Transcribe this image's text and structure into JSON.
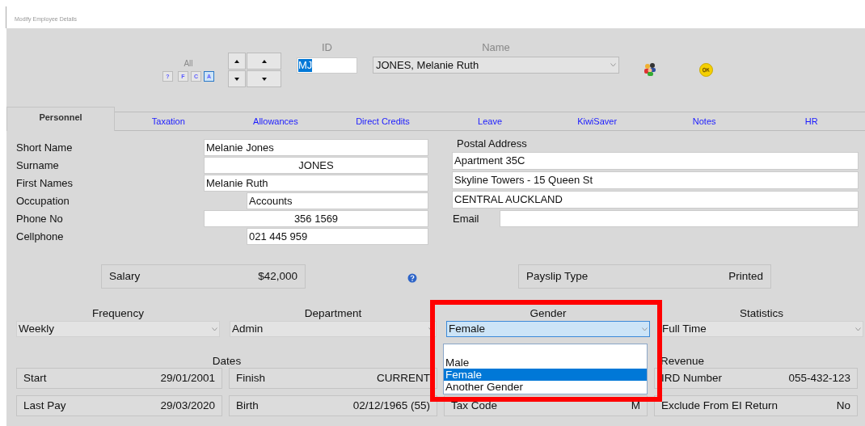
{
  "window": {
    "title": "Modify Employee Details"
  },
  "filter": {
    "label": "All",
    "buttons": [
      {
        "label": "?",
        "selected": false
      },
      {
        "label": "F",
        "selected": false
      },
      {
        "label": "C",
        "selected": false
      },
      {
        "label": "A",
        "selected": true
      }
    ]
  },
  "id": {
    "label": "ID",
    "value": "MJ"
  },
  "name": {
    "label": "Name",
    "value": "JONES, Melanie Ruth"
  },
  "tabs": [
    {
      "label": "Personnel",
      "selected": true
    },
    {
      "label": "Taxation",
      "selected": false
    },
    {
      "label": "Allowances",
      "selected": false
    },
    {
      "label": "Direct Credits",
      "selected": false
    },
    {
      "label": "Leave",
      "selected": false
    },
    {
      "label": "KiwiSaver",
      "selected": false
    },
    {
      "label": "Notes",
      "selected": false
    },
    {
      "label": "HR",
      "selected": false
    }
  ],
  "personal_fields": [
    {
      "label": "Short Name",
      "value": "Melanie Jones"
    },
    {
      "label": "Surname",
      "value": "JONES"
    },
    {
      "label": "First Names",
      "value": "Melanie Ruth"
    },
    {
      "label": "Occupation",
      "value": "Accounts"
    },
    {
      "label": "Phone No",
      "value": "356 1569"
    },
    {
      "label": "Cellphone",
      "value": "021 445 959"
    }
  ],
  "postal_address": {
    "label": "Postal Address",
    "lines": [
      "Apartment 35C",
      "Skyline Towers - 15 Queen St",
      "CENTRAL AUCKLAND"
    ]
  },
  "email": {
    "label": "Email"
  },
  "salary": {
    "label": "Salary",
    "value": "$42,000"
  },
  "payslip_type": {
    "label": "Payslip Type",
    "value": "Printed"
  },
  "dropdowns": [
    {
      "label": "Frequency",
      "value": "Weekly",
      "focused": false
    },
    {
      "label": "Department",
      "value": "Admin",
      "focused": false
    },
    {
      "label": "Gender",
      "value": "Female",
      "focused": true
    },
    {
      "label": "Statistics",
      "value": "Full Time",
      "focused": false
    }
  ],
  "gender_options": [
    {
      "label": "Male",
      "selected": false
    },
    {
      "label": "Female",
      "selected": true
    },
    {
      "label": "Another Gender",
      "selected": false
    }
  ],
  "dates": {
    "title": "Dates",
    "cells": [
      {
        "label": "Start",
        "value": "29/01/2001"
      },
      {
        "label": "Finish",
        "value": "CURRENT"
      },
      {
        "label": "Last Pay",
        "value": "29/03/2020"
      },
      {
        "label": "Birth",
        "value": "02/12/1965 (55)"
      }
    ]
  },
  "revenue": {
    "title": "Revenue",
    "cells": [
      {
        "label": "IRD Number",
        "value": "055-432-123"
      },
      {
        "label": "Tax Code",
        "value": "M"
      },
      {
        "label": "Exclude From EI Return",
        "value": "No"
      }
    ]
  }
}
